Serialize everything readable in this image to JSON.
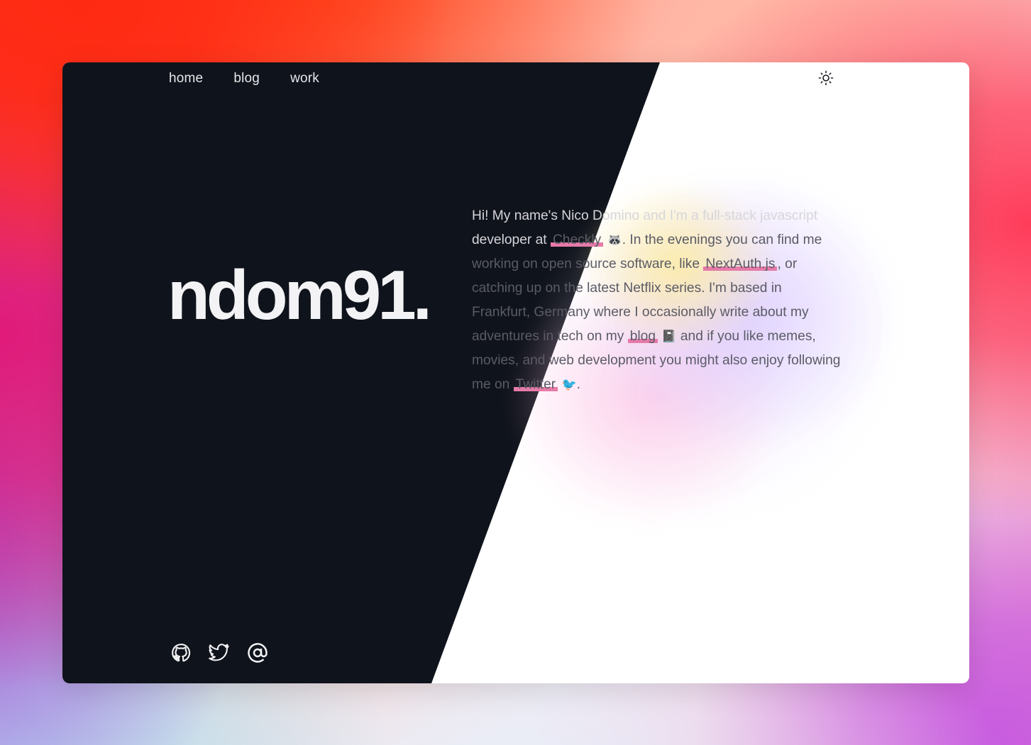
{
  "nav": {
    "items": [
      {
        "label": "home"
      },
      {
        "label": "blog"
      },
      {
        "label": "work"
      }
    ]
  },
  "theme_toggle": {
    "icon": "sun-icon"
  },
  "logo": {
    "text": "ndom91."
  },
  "intro": {
    "part1": "Hi! My name's Nico Domino and I'm a full-stack javascript developer at ",
    "link_checkly": "Checkly",
    "emoji_raccoon": "🦝",
    "part2": ". In the evenings you can find me working on open source software, like ",
    "link_nextauth": "NextAuth.js",
    "part3": ", or catching up on the latest Netflix series. I'm based in Frankfurt, Germany where I occasionally write about my adventures in tech on my ",
    "link_blog": "blog",
    "emoji_notebook": "📓",
    "part4": " and if you like memes, movies, and web development you might also enjoy following me on ",
    "link_twitter": "Twitter",
    "emoji_bird": "🐦",
    "part5": "."
  },
  "socials": [
    {
      "icon": "github-icon"
    },
    {
      "icon": "twitter-icon"
    },
    {
      "icon": "at-sign-icon"
    }
  ],
  "colors": {
    "dark_panel": "#0f131b",
    "card_bg": "#ffffff",
    "link_underline": "#e67aa8",
    "body_text": "#5b5b66"
  }
}
